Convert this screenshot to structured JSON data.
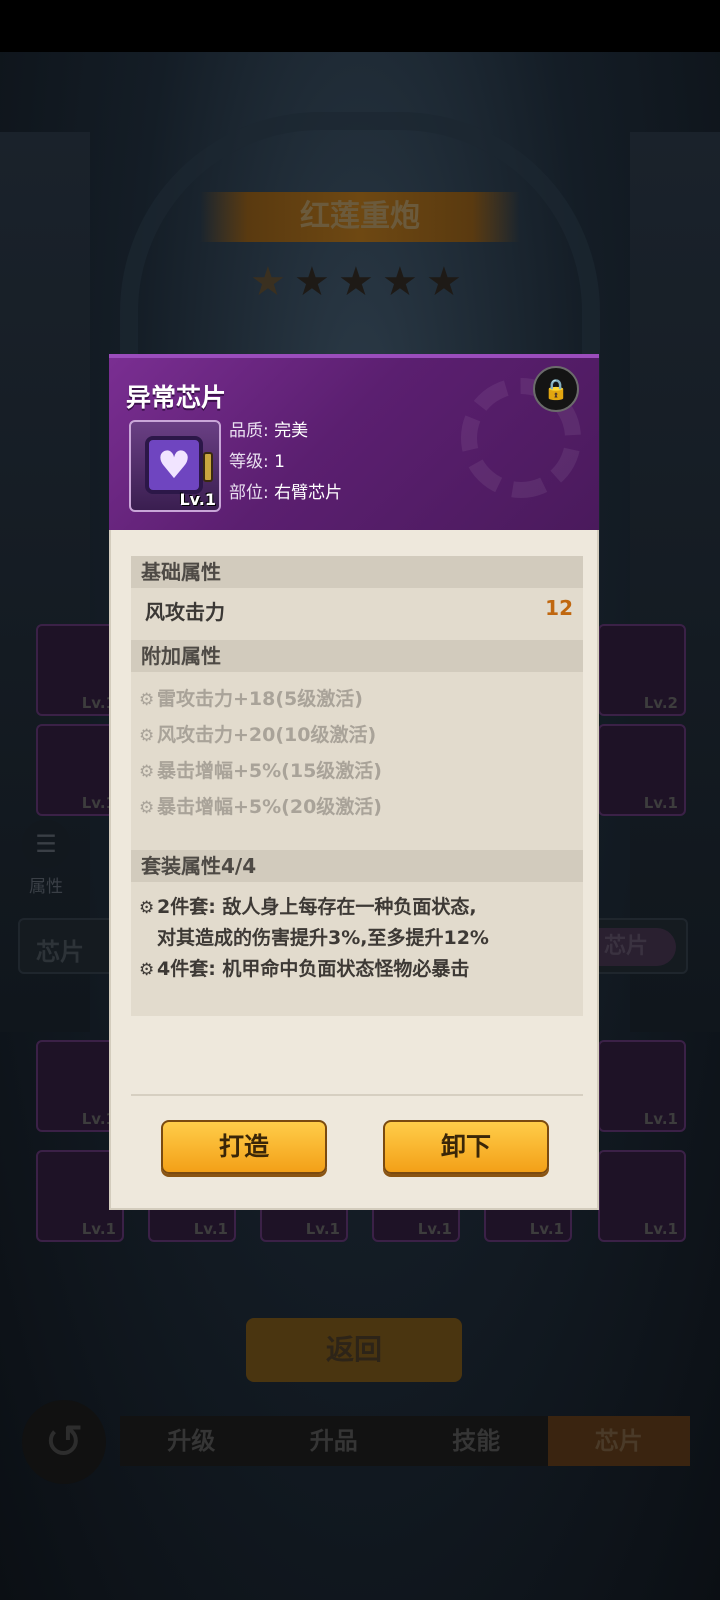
{
  "mech": {
    "title": "红莲重炮",
    "stars_filled": 1,
    "stars_total": 5
  },
  "background": {
    "attr_button_label": "属性",
    "chip_bar_left": "芯片",
    "chip_bar_right": "芯片",
    "slots": [
      {
        "level": "Lv.1"
      },
      {
        "level": "Lv.2"
      },
      {
        "level": "Lv.1"
      },
      {
        "level": "Lv.1"
      },
      {
        "level": "Lv.1"
      },
      {
        "level": "Lv.1"
      },
      {
        "level": "Lv.1"
      },
      {
        "level": "Lv.1"
      },
      {
        "level": "Lv.1"
      },
      {
        "level": "Lv.1"
      },
      {
        "level": "Lv.1"
      },
      {
        "level": "Lv.1"
      }
    ],
    "back_label": "返回",
    "tabs": [
      {
        "label": "升级",
        "active": false
      },
      {
        "label": "升品",
        "active": false
      },
      {
        "label": "技能",
        "active": false
      },
      {
        "label": "芯片",
        "active": true
      }
    ]
  },
  "dialog": {
    "title": "异常芯片",
    "chip_level": "Lv.1",
    "info": [
      {
        "key": "品质:",
        "value": "完美"
      },
      {
        "key": "等级:",
        "value": "1"
      },
      {
        "key": "部位:",
        "value": "右臂芯片"
      }
    ],
    "base_header": "基础属性",
    "base_attr": {
      "name": "风攻击力",
      "value": "12"
    },
    "extra_header": "附加属性",
    "extra_attrs": [
      "雷攻击力+18(5级激活)",
      "风攻击力+20(10级激活)",
      "暴击增幅+5%(15级激活)",
      "暴击增幅+5%(20级激活)"
    ],
    "set_header": "套装属性4/4",
    "set_attrs": [
      {
        "line1": "2件套: 敌人身上每存在一种负面状态,",
        "line2": "对其造成的伤害提升3%,至多提升12%"
      },
      {
        "line1": "4件套: 机甲命中负面状态怪物必暴击",
        "line2": ""
      }
    ],
    "forge_label": "打造",
    "unequip_label": "卸下"
  },
  "colors": {
    "dialog_header": "#5b1f70",
    "value_orange": "#c0670f",
    "button_gold": "#f3a018"
  }
}
